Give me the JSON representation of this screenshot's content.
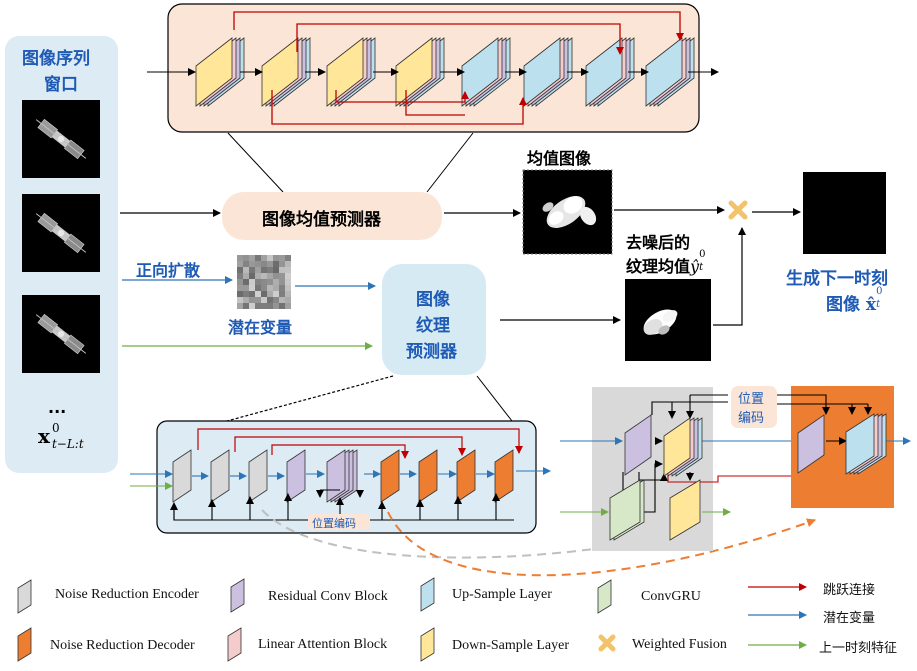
{
  "input_window": {
    "title_line1": "图像序列",
    "title_line2": "窗口",
    "ellipsis": "...",
    "formula_base": "x",
    "formula_sup": "0",
    "formula_sub": "t−L:t"
  },
  "nodes": {
    "mean_predictor": "图像均值预测器",
    "texture_predictor_line1": "图像",
    "texture_predictor_line2": "纹理",
    "texture_predictor_line3": "预测器",
    "forward_diffusion": "正向扩散",
    "latent_variable": "潜在变量",
    "mean_image": "均值图像",
    "denoised_line1": "去噪后的",
    "denoised_line2": "纹理均值",
    "denoised_symbol": "ŷ",
    "denoised_sub": "t",
    "denoised_sup": "0",
    "output_line1": "生成下一时刻",
    "output_line2": "图像",
    "output_symbol": "x̂",
    "output_sub": "t",
    "output_sup": "0",
    "position_encoding": "位置编码",
    "position_encoding_2_line1": "位置",
    "position_encoding_2_line2": "编码"
  },
  "legend": {
    "noise_reduction_encoder": "Noise Reduction Encoder",
    "residual_conv_block": "Residual Conv Block",
    "up_sample_layer": "Up-Sample Layer",
    "convgru": "ConvGRU",
    "skip_connection": "跳跃连接",
    "noise_reduction_decoder": "Noise Reduction Decoder",
    "linear_attention_block": "Linear Attention Block",
    "down_sample_layer": "Down-Sample Layer",
    "weighted_fusion": "Weighted Fusion",
    "latent_variable": "潜在变量",
    "previous_feature": "上一时刻特征"
  },
  "colors": {
    "input_panel": "#dcebf4",
    "unet_panel": "#fbe5d6",
    "mean_node": "#fbe5d6",
    "texture_node": "#d6eaf4",
    "detail_panel": "#dcebf4",
    "gru_panel": "#d9d9d9",
    "orange_panel": "#ed7d31",
    "yellow_block": "#ffe699",
    "blue_block": "#bde0ef",
    "gray_block": "#d9d9d9",
    "purple_block": "#ccc0e0",
    "orange_block": "#ed7d31",
    "green_block": "#d6e8c8",
    "pink_block": "#f4cccc",
    "skip_arrow": "#c00000",
    "latent_arrow": "#2e75b6",
    "feature_arrow": "#70ad47",
    "text_blue": "#1f5bb5"
  }
}
